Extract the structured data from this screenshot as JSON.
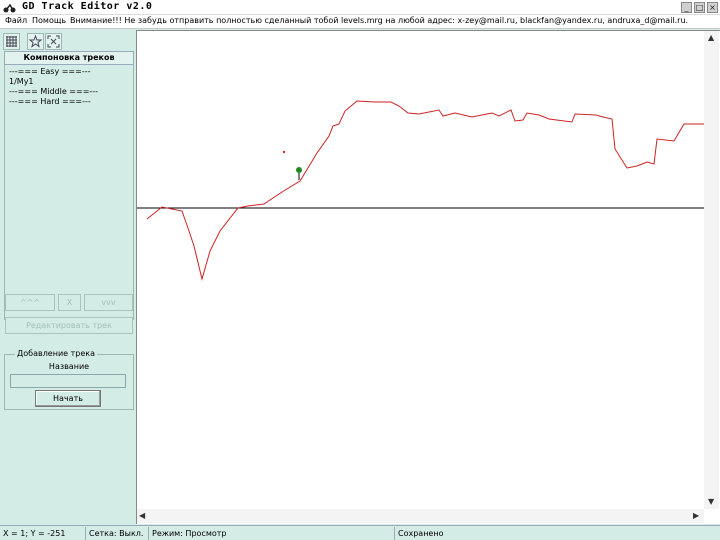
{
  "window": {
    "title": "GD Track Editor v2.0",
    "icon": "app-icon"
  },
  "menu": {
    "file": "Файл",
    "help": "Помощь",
    "notice": "Внимание!!! Не забудь отправить полностью сделанный тобой levels.mrg на любой адрес: x-zey@mail.ru, blackfan@yandex.ru, andruxa_d@mail.ru."
  },
  "toolbar": {
    "icons": [
      "grid-icon",
      "star-icon",
      "fit-icon"
    ]
  },
  "tracks_panel": {
    "header": "Компоновка треков",
    "items": [
      "---=== Easy ===---",
      "1/My1",
      "---=== Middle ===---",
      "---=== Hard ===---"
    ]
  },
  "controls": {
    "up": "^^^",
    "delete": "X",
    "down": "vvv",
    "edit": "Редактировать трек"
  },
  "add_track": {
    "legend": "Добавление трека",
    "name_label": "Название",
    "name_value": "",
    "start": "Начать"
  },
  "status": {
    "coords": "X = 1; Y = -251",
    "grid": "Сетка: Выкл.",
    "mode": "Режим: Просмотр",
    "saved": "Сохранено"
  },
  "colors": {
    "track": "#cc2222",
    "start_marker": "#1e8a1e",
    "axis": "#000000",
    "panel_bg": "#d4ece6"
  }
}
